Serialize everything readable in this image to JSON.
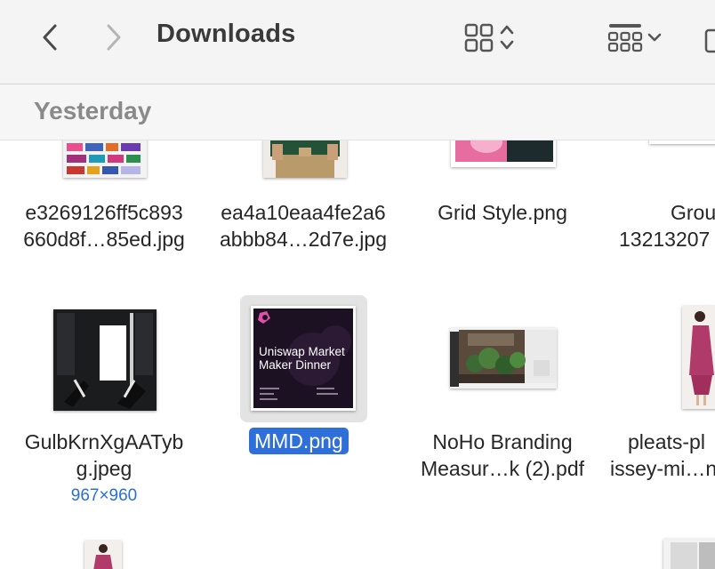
{
  "window": {
    "title": "Downloads"
  },
  "toolbar": {
    "back_icon": "chevron-left-icon",
    "forward_icon": "chevron-right-icon",
    "view_icon": "grid-view-icon",
    "group_icon": "group-by-icon"
  },
  "section": {
    "label": "Yesterday"
  },
  "files": {
    "f1": {
      "line1": "e3269126ff5c893",
      "line2": "660d8f…85ed.jpg"
    },
    "f2": {
      "line1": "ea4a10eaa4fe2a6",
      "line2": "abbb84…2d7e.jpg"
    },
    "f3": {
      "line1": "Grid Style.png"
    },
    "f4": {
      "line1": "Grou",
      "line2": "13213207"
    },
    "f5": {
      "line1": "GulbKrnXgAATyb",
      "line2": "g.jpeg",
      "dims": "967×960"
    },
    "f6": {
      "line1": "MMD.png",
      "thumb_text": "Uniswap Market Maker Dinner"
    },
    "f7": {
      "line1": "NoHo Branding",
      "line2": "Measur…k (2).pdf"
    },
    "f8": {
      "line1": "pleats-pl",
      "line2": "issey-mi…n"
    }
  },
  "colors": {
    "selection": "#2e6fd9",
    "dimensions": "#2b6fd6"
  }
}
